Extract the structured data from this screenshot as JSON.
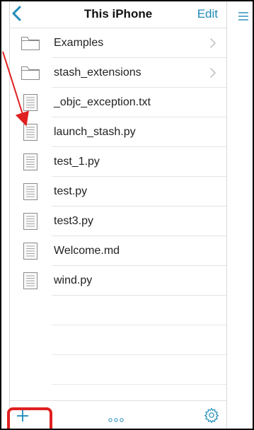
{
  "nav": {
    "title": "This iPhone",
    "edit_label": "Edit",
    "back_icon": "chevron-left-icon"
  },
  "files": [
    {
      "name": "Examples",
      "type": "folder",
      "has_chevron": true
    },
    {
      "name": "stash_extensions",
      "type": "folder",
      "has_chevron": true
    },
    {
      "name": "_objc_exception.txt",
      "type": "file",
      "has_chevron": false
    },
    {
      "name": "launch_stash.py",
      "type": "file",
      "has_chevron": false
    },
    {
      "name": "test_1.py",
      "type": "file",
      "has_chevron": false
    },
    {
      "name": "test.py",
      "type": "file",
      "has_chevron": false
    },
    {
      "name": "test3.py",
      "type": "file",
      "has_chevron": false
    },
    {
      "name": "Welcome.md",
      "type": "file",
      "has_chevron": false
    },
    {
      "name": "wind.py",
      "type": "file",
      "has_chevron": false
    }
  ],
  "toolbar": {
    "add_icon": "plus-icon",
    "more_icon": "more-dots-icon",
    "settings_icon": "gear-icon"
  },
  "side": {
    "menu_icon": "hamburger-menu-icon"
  },
  "colors": {
    "accent": "#1e8ab8",
    "annotation": "#e02020",
    "icon_stroke": "#8a8a8a"
  }
}
